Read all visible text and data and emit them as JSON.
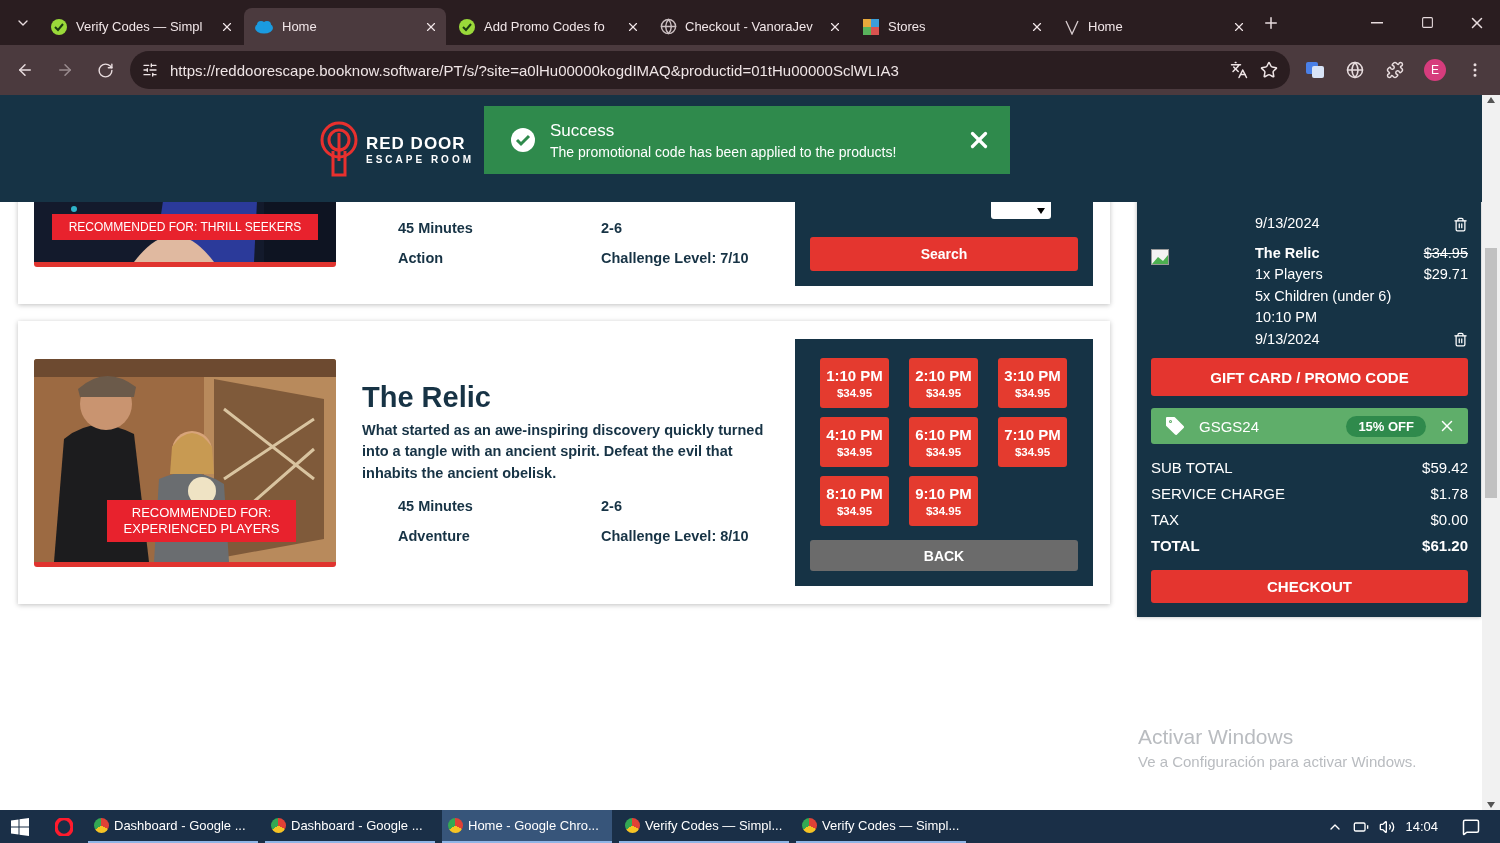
{
  "browser": {
    "tabs": [
      {
        "title": "Verify Codes — Simpl",
        "selected": false
      },
      {
        "title": "Home",
        "selected": true
      },
      {
        "title": "Add Promo Codes fo",
        "selected": false
      },
      {
        "title": "Checkout - VanoraJev",
        "selected": false
      },
      {
        "title": "Stores",
        "selected": false
      },
      {
        "title": "Home",
        "selected": false
      }
    ],
    "url": "https://reddoorescape.booknow.software/PT/s/?site=a0lHu00000kogdIMAQ&productid=01tHu00000SclWLIA3",
    "profile": "E"
  },
  "header": {
    "logo": {
      "line_1": "RED DOOR",
      "line_2": "ESCAPE ROOM"
    },
    "toast": {
      "title": "Success",
      "message": "The promotional code has been applied to the products!"
    }
  },
  "rooms": [
    {
      "badge": "RECOMMENDED FOR: THRILL SEEKERS",
      "duration": "45 Minutes",
      "players": "2-6",
      "genre": "Action",
      "challenge": "Challenge Level: 7/10",
      "panel": {
        "kind": "search",
        "button": "Search"
      }
    },
    {
      "title": "The Relic",
      "description": "What started as an awe-inspiring discovery quickly turned into a tangle with an ancient spirit. Defeat the evil that inhabits the ancient obelisk.",
      "badge": "RECOMMENDED FOR: EXPERIENCED PLAYERS",
      "duration": "45 Minutes",
      "players": "2-6",
      "genre": "Adventure",
      "challenge": "Challenge Level: 8/10",
      "panel": {
        "kind": "slots",
        "slots": [
          {
            "time": "1:10 PM",
            "price": "$34.95"
          },
          {
            "time": "2:10 PM",
            "price": "$34.95"
          },
          {
            "time": "3:10 PM",
            "price": "$34.95"
          },
          {
            "time": "4:10 PM",
            "price": "$34.95"
          },
          {
            "time": "6:10 PM",
            "price": "$34.95"
          },
          {
            "time": "7:10 PM",
            "price": "$34.95"
          },
          {
            "time": "8:10 PM",
            "price": "$34.95"
          },
          {
            "time": "9:10 PM",
            "price": "$34.95"
          }
        ],
        "button": "BACK"
      }
    }
  ],
  "cart": {
    "items": [
      {
        "image": false,
        "lines": [
          "9/13/2024"
        ]
      },
      {
        "image": true,
        "lines": [
          "The Relic",
          "1x Players",
          "5x Children (under 6)",
          "10:10 PM",
          "9/13/2024"
        ],
        "price_original": "$34.95",
        "price": "$29.71"
      }
    ],
    "promo_button": "GIFT CARD / PROMO CODE",
    "promo": {
      "code": "GSGS24",
      "discount": "15% OFF"
    },
    "totals": [
      {
        "label": "SUB TOTAL",
        "value": "$59.42",
        "strong": false
      },
      {
        "label": "SERVICE CHARGE",
        "value": "$1.78",
        "strong": false
      },
      {
        "label": "TAX",
        "value": "$0.00",
        "strong": false
      },
      {
        "label": "TOTAL",
        "value": "$61.20",
        "strong": true
      }
    ],
    "checkout": "CHECKOUT"
  },
  "activation": {
    "title": "Activar Windows",
    "subtitle": "Ve a Configuración para activar Windows."
  },
  "taskbar": {
    "items": [
      {
        "label": "Dashboard - Google ...",
        "selected": false
      },
      {
        "label": "Dashboard - Google ...",
        "selected": false
      },
      {
        "label": "Home - Google Chro...",
        "selected": true
      },
      {
        "label": "Verify Codes — Simpl...",
        "selected": false
      },
      {
        "label": "Verify Codes — Simpl...",
        "selected": false
      }
    ],
    "time": "14:04"
  }
}
